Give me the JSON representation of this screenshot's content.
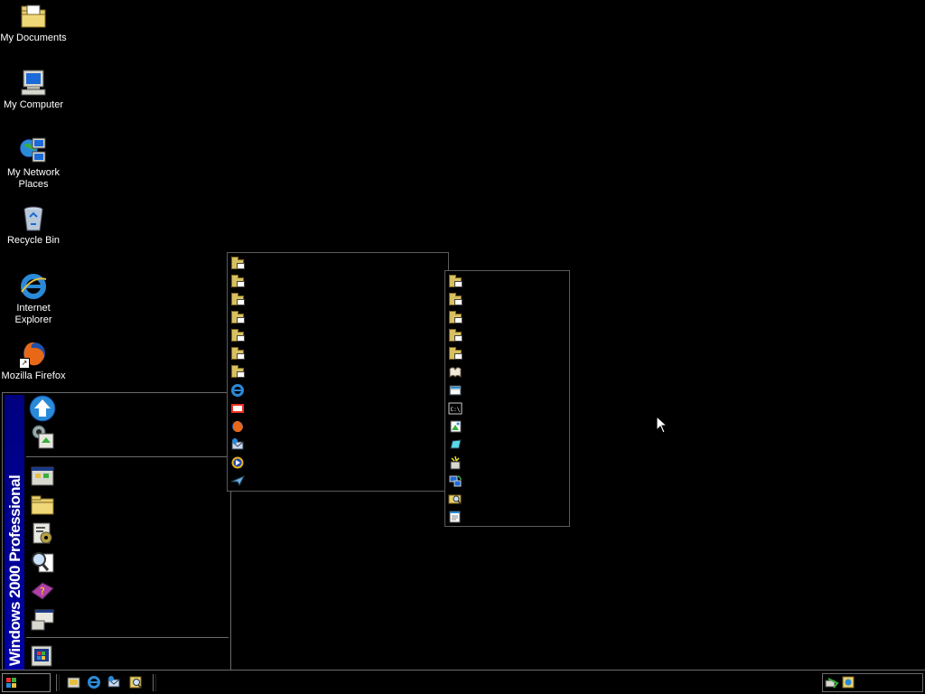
{
  "desktop": {
    "icons": [
      {
        "label": "My Documents",
        "icon": "my-documents-icon"
      },
      {
        "label": "My Computer",
        "icon": "my-computer-icon"
      },
      {
        "label": "My Network Places",
        "icon": "network-places-icon"
      },
      {
        "label": "Recycle Bin",
        "icon": "recycle-bin-icon"
      },
      {
        "label": "Internet Explorer",
        "icon": "internet-explorer-icon"
      },
      {
        "label": "Mozilla Firefox",
        "icon": "firefox-icon"
      }
    ]
  },
  "start_menu": {
    "banner_text": "Windows 2000 Professional",
    "top_items": [
      "windows-update-icon",
      "set-program-access-icon"
    ],
    "main_items": [
      "programs-icon",
      "documents-icon",
      "settings-icon",
      "search-icon",
      "help-icon",
      "run-icon"
    ],
    "bottom_items": [
      "shutdown-icon"
    ]
  },
  "programs_menu": {
    "items": [
      "folder-icon",
      "folder-icon",
      "folder-icon",
      "folder-icon",
      "folder-icon",
      "folder-icon",
      "folder-icon",
      "internet-explorer-icon",
      "vlc-icon",
      "firefox-icon",
      "outlook-express-icon",
      "windows-media-player-icon",
      "send-to-icon"
    ]
  },
  "accessories_menu": {
    "items": [
      "folder-icon",
      "folder-icon",
      "folder-icon",
      "folder-icon",
      "folder-icon",
      "address-book-icon",
      "calculator-icon",
      "command-prompt-icon",
      "imaging-icon",
      "paint-icon",
      "program-compatibility-icon",
      "synchronize-icon",
      "windows-explorer-icon",
      "notepad-icon"
    ]
  },
  "taskbar": {
    "quick_launch": [
      "show-desktop-icon",
      "internet-explorer-icon",
      "outlook-express-icon",
      "search-icon"
    ],
    "tray": [
      "network-icon",
      "volume-icon"
    ]
  },
  "colors": {
    "desktop_bg": "#000000",
    "banner_blue": "#000080",
    "folder_yellow": "#d8c060"
  }
}
